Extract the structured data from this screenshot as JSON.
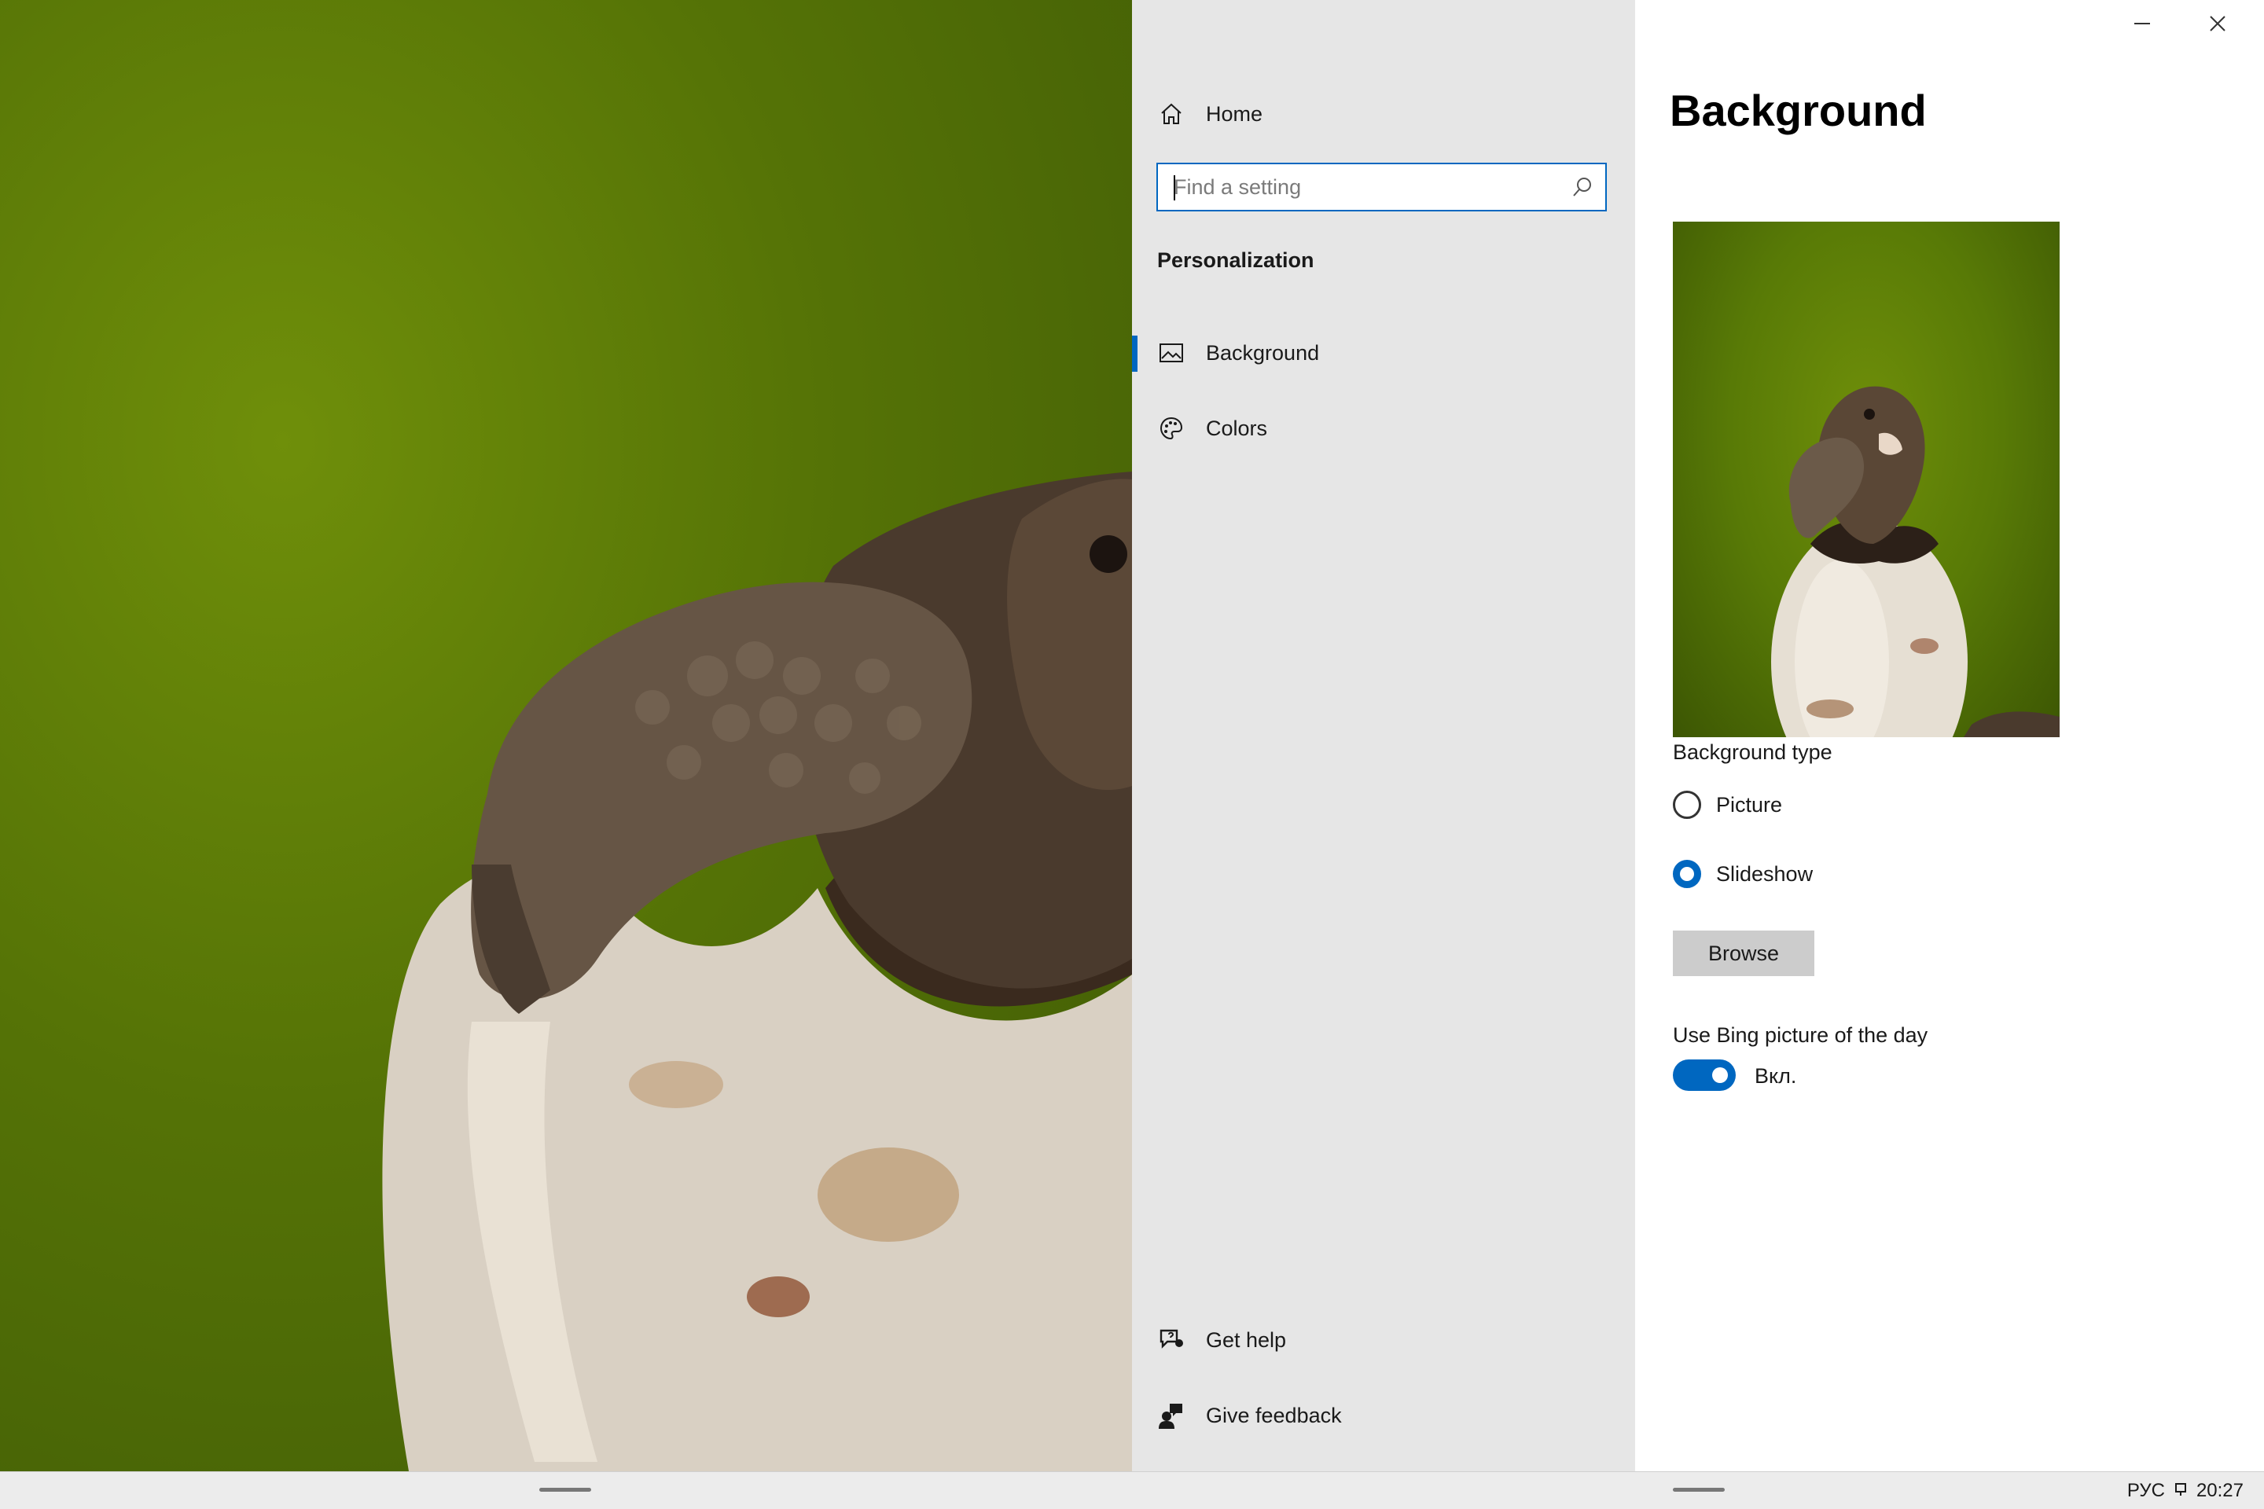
{
  "window": {
    "minimize_icon": "minimize-icon",
    "close_icon": "close-icon"
  },
  "nav": {
    "home": {
      "label": "Home",
      "icon": "home-icon"
    },
    "search": {
      "placeholder": "Find a setting",
      "value": "",
      "icon": "search-icon"
    },
    "section_title": "Personalization",
    "items": [
      {
        "label": "Background",
        "icon": "picture-icon",
        "selected": true
      },
      {
        "label": "Colors",
        "icon": "palette-icon",
        "selected": false
      }
    ],
    "footer": [
      {
        "label": "Get help",
        "icon": "help-chat-icon"
      },
      {
        "label": "Give feedback",
        "icon": "feedback-person-icon"
      }
    ]
  },
  "content": {
    "title": "Background",
    "background_type_label": "Background type",
    "radio_options": [
      {
        "label": "Picture",
        "checked": false
      },
      {
        "label": "Slideshow",
        "checked": true
      }
    ],
    "browse_label": "Browse",
    "bing": {
      "label": "Use Bing picture of the day",
      "on": true,
      "state_text": "Вкл."
    }
  },
  "taskbar": {
    "language": "РУС",
    "time": "20:27"
  },
  "colors": {
    "accent": "#0067c0",
    "nav_bg": "#e6e6e6",
    "content_bg": "#ffffff"
  }
}
